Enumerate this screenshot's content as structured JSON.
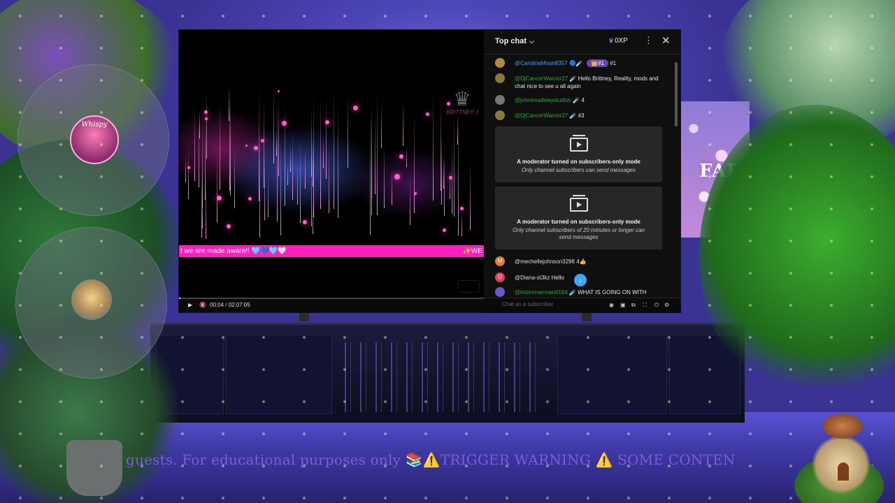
{
  "scene": {
    "board_text": "FAFO",
    "avatar1_text": "Whispy",
    "marquee_text": "guests. For educational purposes only 📚⚠️TRIGGER WARNING ⚠️ SOME CONTEN"
  },
  "video": {
    "watermark_text": "BRITTNEY J",
    "ticker_left": "t we are made aware!! 🩵💙🩵🤍",
    "ticker_right": "✨WE",
    "time_current": "00:04",
    "time_total": "02:07:05",
    "time_display": "00:04 / 02:07:05",
    "progress_fraction": 0.0005
  },
  "chat": {
    "title": "Top chat",
    "xp_label": "0XP",
    "messages": [
      {
        "author": "@CarolinaMoon8357",
        "author_color": "#3ea6ff",
        "suffix": "🔵☄️",
        "chip": "👑#1",
        "text": "#1",
        "avatar_color": "#b08c3a"
      },
      {
        "author": "@DjCancerWarrior27",
        "author_color": "#2ba640",
        "suffix": "☄️",
        "text": "Hello Brittney, Reality, mods and chat nice to see u all again",
        "avatar_color": "#8a7a3a"
      },
      {
        "author": "@johntreadwaystudios",
        "author_color": "#2ba640",
        "suffix": "☄️",
        "text": "4",
        "avatar_color": "#777777"
      },
      {
        "author": "@DjCancerWarrior27",
        "author_color": "#2ba640",
        "suffix": "☄️",
        "text": "#3",
        "avatar_color": "#8a7a3a"
      },
      {
        "author": "@mechellejohnson3298",
        "author_color": "#dddddd",
        "suffix": "",
        "text": "4👍",
        "avatar_color": "#e07a3a",
        "avatar_letter": "M"
      },
      {
        "author": "@Diana-st3kz",
        "author_color": "#dddddd",
        "suffix": "",
        "text": "Hello",
        "avatar_color": "#e0405a",
        "avatar_letter": "D"
      },
      {
        "author": "@leizimmerman6184",
        "author_color": "#2ba640",
        "suffix": "☄️",
        "text": "WHAT IS GOING ON WITH",
        "avatar_color": "#6a5acd"
      }
    ],
    "system_cards": [
      {
        "title": "A moderator turned on subscribers-only mode",
        "subtitle": "Only channel subscribers can send messages"
      },
      {
        "title": "A moderator turned on subscribers-only mode",
        "subtitle": "Only channel subscribers of 20 minutes or longer can send messages"
      }
    ],
    "input_placeholder": "Chat as a subscriber"
  },
  "icons": {
    "play": "play-icon",
    "mute": "volume-mute-icon",
    "close": "close-icon",
    "more": "more-vert-icon",
    "jump": "arrow-down-icon"
  }
}
